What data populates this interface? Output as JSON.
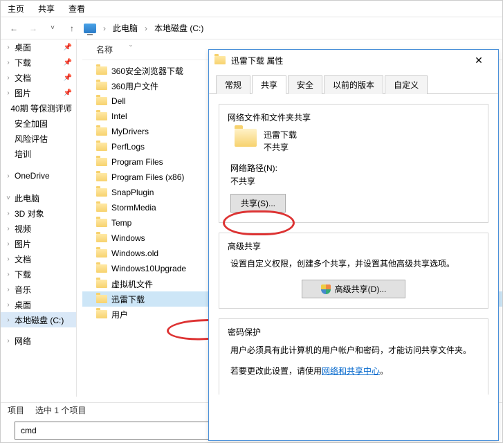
{
  "menu": {
    "home": "主页",
    "share": "共享",
    "view": "查看"
  },
  "breadcrumb": {
    "pc": "此电脑",
    "drive": "本地磁盘 (C:)"
  },
  "nav": {
    "items": [
      {
        "label": "桌面",
        "pin": true,
        "chev": ">"
      },
      {
        "label": "下载",
        "pin": true,
        "chev": ">"
      },
      {
        "label": "文档",
        "pin": true,
        "chev": ">"
      },
      {
        "label": "图片",
        "pin": true,
        "chev": ">"
      },
      {
        "label": "40期 等保测评师",
        "pin": false,
        "chev": ""
      },
      {
        "label": "安全加固",
        "pin": false,
        "chev": ""
      },
      {
        "label": "风险评估",
        "pin": false,
        "chev": ""
      },
      {
        "label": "培训",
        "pin": false,
        "chev": ""
      }
    ],
    "gap1": "",
    "onedrive": "OneDrive",
    "thispc": "此电脑",
    "pcitems": [
      "3D 对象",
      "视频",
      "图片",
      "文档",
      "下载",
      "音乐",
      "桌面"
    ],
    "drive": "本地磁盘 (C:)",
    "network": "网络"
  },
  "header": {
    "name": "名称"
  },
  "files": [
    "360安全浏览器下载",
    "360用户文件",
    "Dell",
    "Intel",
    "MyDrivers",
    "PerfLogs",
    "Program Files",
    "Program Files (x86)",
    "SnapPlugin",
    "StormMedia",
    "Temp",
    "Windows",
    "Windows.old",
    "Windows10Upgrade",
    "虚拟机文件",
    "迅雷下载",
    "用户"
  ],
  "selectedFile": "迅雷下载",
  "status": {
    "items": "项目",
    "selected": "选中 1 个项目"
  },
  "run": {
    "value": "cmd"
  },
  "dialog": {
    "title": "迅雷下载 属性",
    "tabs": {
      "general": "常规",
      "share": "共享",
      "security": "安全",
      "prev": "以前的版本",
      "custom": "自定义"
    },
    "section1": {
      "title": "网络文件和文件夹共享",
      "name": "迅雷下载",
      "status": "不共享",
      "pathLabel": "网络路径(N):",
      "pathValue": "不共享",
      "shareBtn": "共享(S)..."
    },
    "section2": {
      "title": "高级共享",
      "desc": "设置自定义权限，创建多个共享，并设置其他高级共享选项。",
      "btn": "高级共享(D)..."
    },
    "section3": {
      "title": "密码保护",
      "line1": "用户必须具有此计算机的用户帐户和密码，才能访问共享文件夹。",
      "line2a": "若要更改此设置，请使用",
      "link": "网络和共享中心",
      "line2b": "。"
    }
  }
}
